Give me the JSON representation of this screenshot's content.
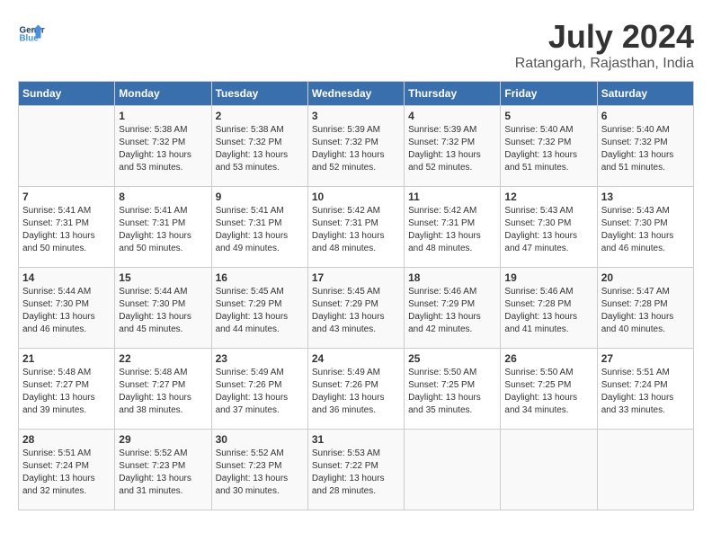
{
  "header": {
    "logo_line1": "General",
    "logo_line2": "Blue",
    "title": "July 2024",
    "subtitle": "Ratangarh, Rajasthan, India"
  },
  "weekdays": [
    "Sunday",
    "Monday",
    "Tuesday",
    "Wednesday",
    "Thursday",
    "Friday",
    "Saturday"
  ],
  "weeks": [
    [
      {
        "day": "",
        "info": ""
      },
      {
        "day": "1",
        "info": "Sunrise: 5:38 AM\nSunset: 7:32 PM\nDaylight: 13 hours\nand 53 minutes."
      },
      {
        "day": "2",
        "info": "Sunrise: 5:38 AM\nSunset: 7:32 PM\nDaylight: 13 hours\nand 53 minutes."
      },
      {
        "day": "3",
        "info": "Sunrise: 5:39 AM\nSunset: 7:32 PM\nDaylight: 13 hours\nand 52 minutes."
      },
      {
        "day": "4",
        "info": "Sunrise: 5:39 AM\nSunset: 7:32 PM\nDaylight: 13 hours\nand 52 minutes."
      },
      {
        "day": "5",
        "info": "Sunrise: 5:40 AM\nSunset: 7:32 PM\nDaylight: 13 hours\nand 51 minutes."
      },
      {
        "day": "6",
        "info": "Sunrise: 5:40 AM\nSunset: 7:32 PM\nDaylight: 13 hours\nand 51 minutes."
      }
    ],
    [
      {
        "day": "7",
        "info": "Sunrise: 5:41 AM\nSunset: 7:31 PM\nDaylight: 13 hours\nand 50 minutes."
      },
      {
        "day": "8",
        "info": "Sunrise: 5:41 AM\nSunset: 7:31 PM\nDaylight: 13 hours\nand 50 minutes."
      },
      {
        "day": "9",
        "info": "Sunrise: 5:41 AM\nSunset: 7:31 PM\nDaylight: 13 hours\nand 49 minutes."
      },
      {
        "day": "10",
        "info": "Sunrise: 5:42 AM\nSunset: 7:31 PM\nDaylight: 13 hours\nand 48 minutes."
      },
      {
        "day": "11",
        "info": "Sunrise: 5:42 AM\nSunset: 7:31 PM\nDaylight: 13 hours\nand 48 minutes."
      },
      {
        "day": "12",
        "info": "Sunrise: 5:43 AM\nSunset: 7:30 PM\nDaylight: 13 hours\nand 47 minutes."
      },
      {
        "day": "13",
        "info": "Sunrise: 5:43 AM\nSunset: 7:30 PM\nDaylight: 13 hours\nand 46 minutes."
      }
    ],
    [
      {
        "day": "14",
        "info": "Sunrise: 5:44 AM\nSunset: 7:30 PM\nDaylight: 13 hours\nand 46 minutes."
      },
      {
        "day": "15",
        "info": "Sunrise: 5:44 AM\nSunset: 7:30 PM\nDaylight: 13 hours\nand 45 minutes."
      },
      {
        "day": "16",
        "info": "Sunrise: 5:45 AM\nSunset: 7:29 PM\nDaylight: 13 hours\nand 44 minutes."
      },
      {
        "day": "17",
        "info": "Sunrise: 5:45 AM\nSunset: 7:29 PM\nDaylight: 13 hours\nand 43 minutes."
      },
      {
        "day": "18",
        "info": "Sunrise: 5:46 AM\nSunset: 7:29 PM\nDaylight: 13 hours\nand 42 minutes."
      },
      {
        "day": "19",
        "info": "Sunrise: 5:46 AM\nSunset: 7:28 PM\nDaylight: 13 hours\nand 41 minutes."
      },
      {
        "day": "20",
        "info": "Sunrise: 5:47 AM\nSunset: 7:28 PM\nDaylight: 13 hours\nand 40 minutes."
      }
    ],
    [
      {
        "day": "21",
        "info": "Sunrise: 5:48 AM\nSunset: 7:27 PM\nDaylight: 13 hours\nand 39 minutes."
      },
      {
        "day": "22",
        "info": "Sunrise: 5:48 AM\nSunset: 7:27 PM\nDaylight: 13 hours\nand 38 minutes."
      },
      {
        "day": "23",
        "info": "Sunrise: 5:49 AM\nSunset: 7:26 PM\nDaylight: 13 hours\nand 37 minutes."
      },
      {
        "day": "24",
        "info": "Sunrise: 5:49 AM\nSunset: 7:26 PM\nDaylight: 13 hours\nand 36 minutes."
      },
      {
        "day": "25",
        "info": "Sunrise: 5:50 AM\nSunset: 7:25 PM\nDaylight: 13 hours\nand 35 minutes."
      },
      {
        "day": "26",
        "info": "Sunrise: 5:50 AM\nSunset: 7:25 PM\nDaylight: 13 hours\nand 34 minutes."
      },
      {
        "day": "27",
        "info": "Sunrise: 5:51 AM\nSunset: 7:24 PM\nDaylight: 13 hours\nand 33 minutes."
      }
    ],
    [
      {
        "day": "28",
        "info": "Sunrise: 5:51 AM\nSunset: 7:24 PM\nDaylight: 13 hours\nand 32 minutes."
      },
      {
        "day": "29",
        "info": "Sunrise: 5:52 AM\nSunset: 7:23 PM\nDaylight: 13 hours\nand 31 minutes."
      },
      {
        "day": "30",
        "info": "Sunrise: 5:52 AM\nSunset: 7:23 PM\nDaylight: 13 hours\nand 30 minutes."
      },
      {
        "day": "31",
        "info": "Sunrise: 5:53 AM\nSunset: 7:22 PM\nDaylight: 13 hours\nand 28 minutes."
      },
      {
        "day": "",
        "info": ""
      },
      {
        "day": "",
        "info": ""
      },
      {
        "day": "",
        "info": ""
      }
    ]
  ]
}
